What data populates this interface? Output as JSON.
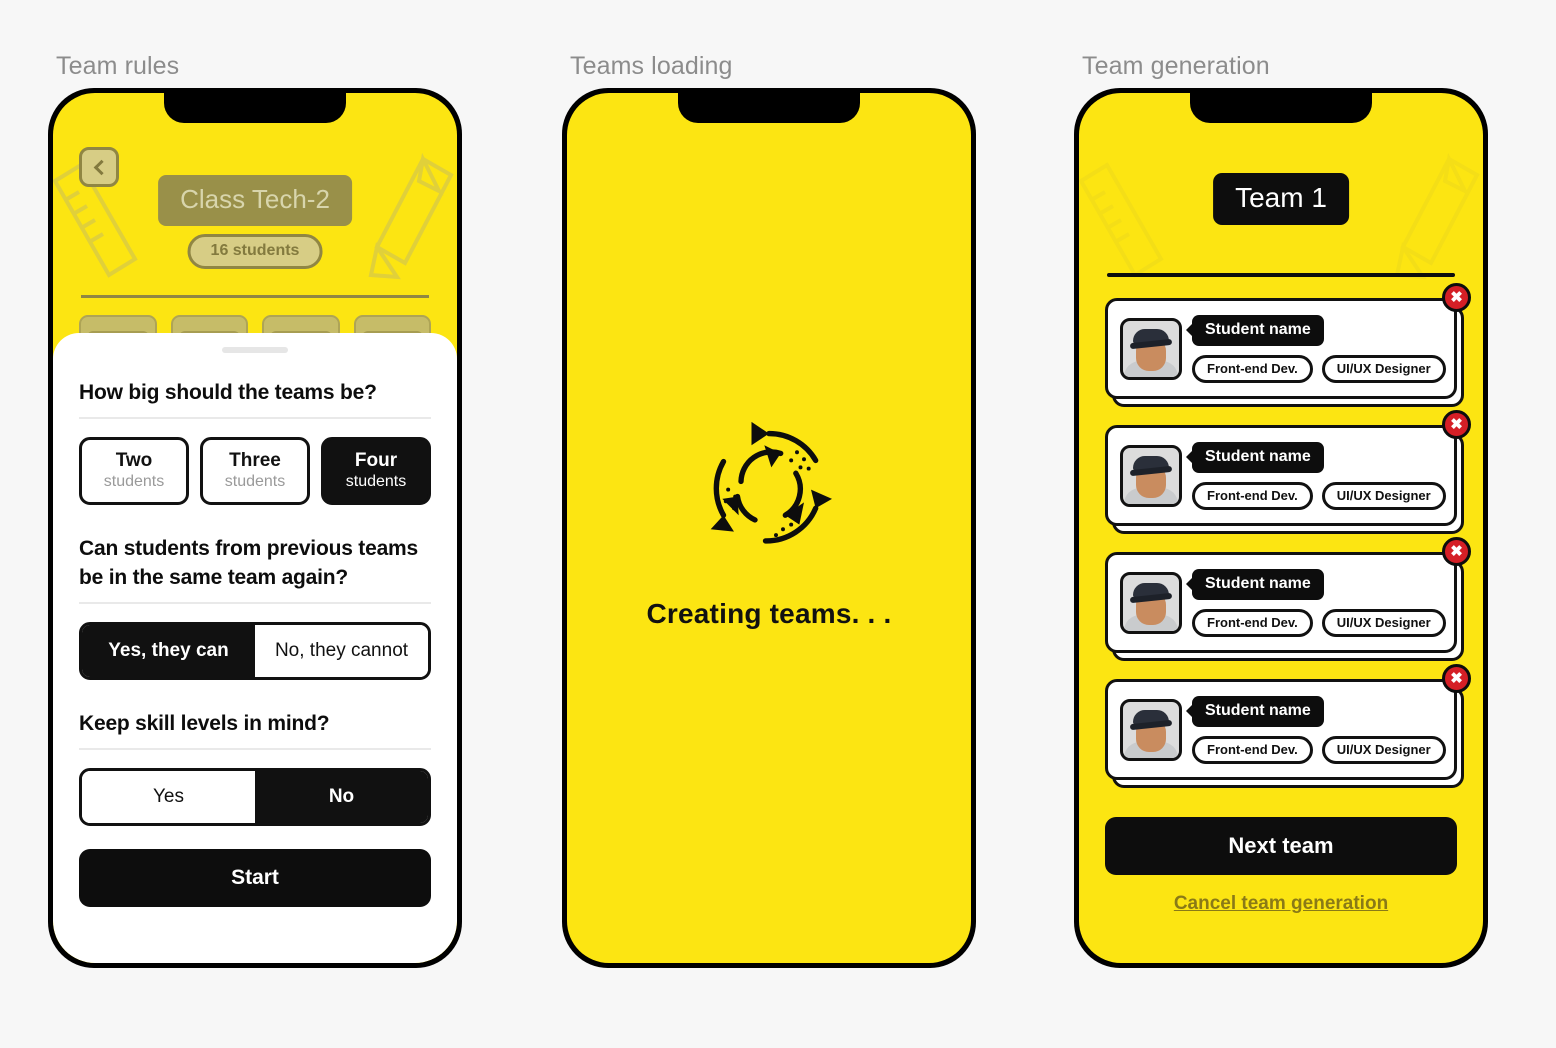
{
  "screens": [
    {
      "label": "Team rules"
    },
    {
      "label": "Teams loading"
    },
    {
      "label": "Team generation"
    }
  ],
  "team_rules": {
    "back_icon": "chevron-left-icon",
    "class_name": "Class Tech-2",
    "student_count": "16 students",
    "sheet": {
      "question_size": "How big should the teams be?",
      "size_options": [
        {
          "count": "Two",
          "unit": "students",
          "selected": false
        },
        {
          "count": "Three",
          "unit": "students",
          "selected": false
        },
        {
          "count": "Four",
          "unit": "students",
          "selected": true
        }
      ],
      "question_repeat": "Can students from previous teams be in the same team again?",
      "repeat_options": [
        {
          "label": "Yes, they can",
          "selected": true
        },
        {
          "label": "No, they cannot",
          "selected": false
        }
      ],
      "question_skill": "Keep skill levels in mind?",
      "skill_options": [
        {
          "label": "Yes",
          "selected": false
        },
        {
          "label": "No",
          "selected": true
        }
      ],
      "start_label": "Start"
    }
  },
  "teams_loading": {
    "spinner_icon": "recycle-arrows-icon",
    "status_text": "Creating teams. . ."
  },
  "team_generation": {
    "team_label": "Team 1",
    "close_icon": "close-circle-icon",
    "students": [
      {
        "name": "Student name",
        "avatar": "student-photo",
        "skills": [
          "Front-end Dev.",
          "UI/UX Designer"
        ]
      },
      {
        "name": "Student name",
        "avatar": "student-photo",
        "skills": [
          "Front-end Dev.",
          "UI/UX Designer"
        ]
      },
      {
        "name": "Student name",
        "avatar": "student-photo",
        "skills": [
          "Front-end Dev.",
          "UI/UX Designer"
        ]
      },
      {
        "name": "Student name",
        "avatar": "student-photo",
        "skills": [
          "Front-end Dev.",
          "UI/UX Designer"
        ]
      }
    ],
    "next_label": "Next team",
    "cancel_label": "Cancel team generation"
  },
  "colors": {
    "yellow": "#FCE512",
    "black": "#0d0d0d",
    "red": "#d51f26",
    "olive": "#8a7a17",
    "page_bg": "#f7f7f7"
  }
}
